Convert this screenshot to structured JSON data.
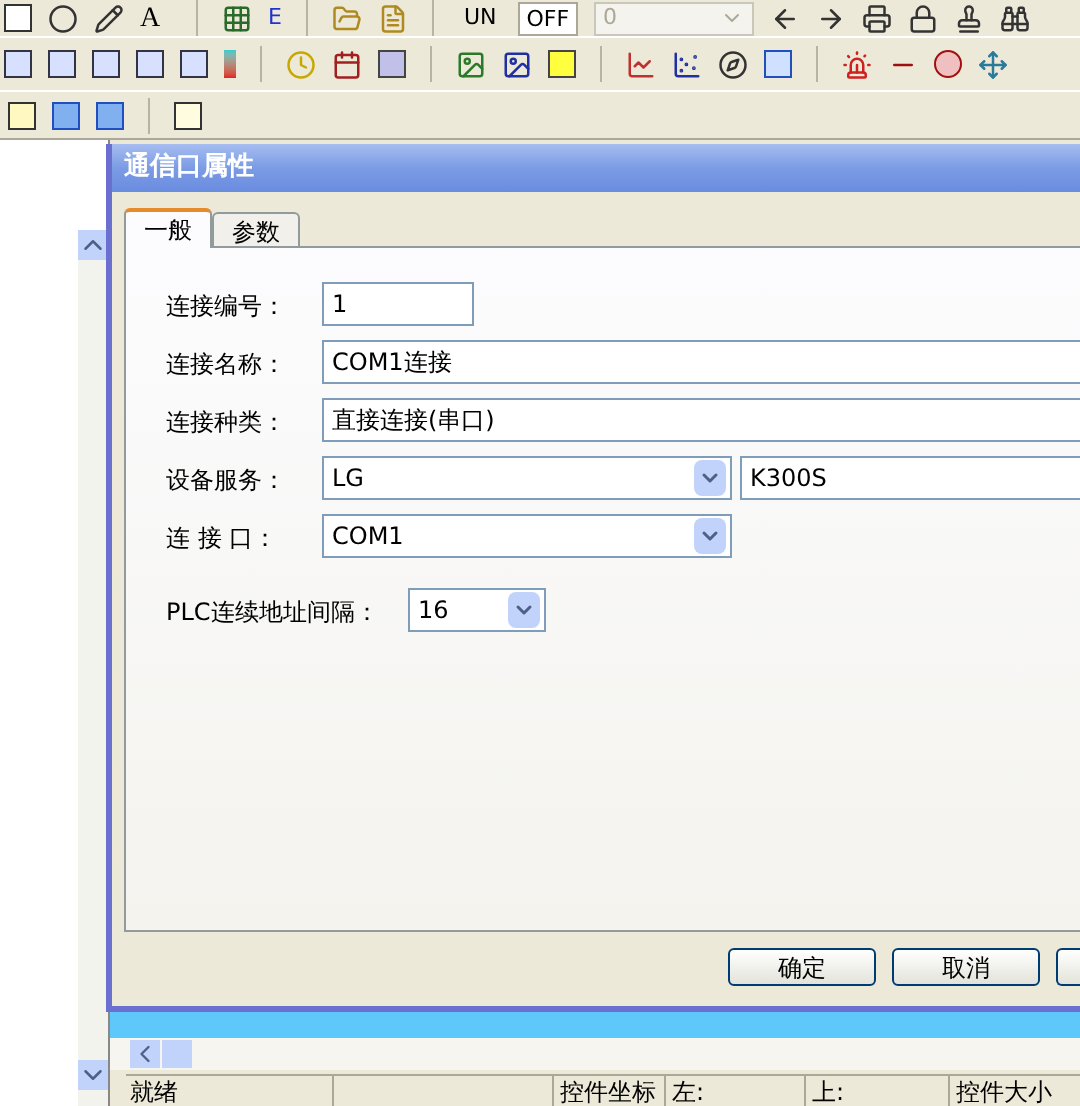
{
  "toolbar": {
    "row1_texts": [
      "A",
      "E"
    ],
    "toggles": [
      "UN",
      "OFF"
    ],
    "combo": {
      "value": "0"
    }
  },
  "dialog": {
    "title": "通信口属性",
    "tabs": [
      {
        "label": "一般",
        "selected": true
      },
      {
        "label": "参数",
        "selected": false
      }
    ],
    "fields": [
      {
        "kind": "text",
        "label": "连接编号：",
        "value": "1"
      },
      {
        "kind": "text",
        "label": "连接名称：",
        "value": "COM1连接"
      },
      {
        "kind": "text",
        "label": "连接种类：",
        "value": "直接连接(串口)"
      },
      {
        "kind": "combo_pair",
        "label": "设备服务：",
        "value": "LG",
        "extra": "K300S"
      },
      {
        "kind": "combo",
        "label": "连 接 口：",
        "value": "COM1"
      },
      {
        "kind": "small_combo",
        "label": "PLC连续地址间隔：",
        "value": "16"
      }
    ],
    "buttons": [
      "确定",
      "取消"
    ]
  },
  "status_bar": [
    "就绪",
    "控件坐标",
    "左:",
    "上:",
    "控件大小"
  ]
}
